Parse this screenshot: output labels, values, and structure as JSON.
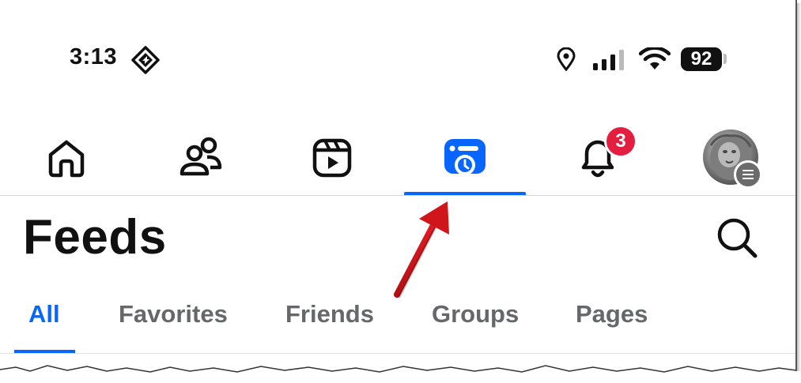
{
  "status_bar": {
    "time": "3:13",
    "battery": "92",
    "icons": [
      "location-icon",
      "signal-icon",
      "wifi-icon",
      "battery-icon"
    ]
  },
  "nav": {
    "items": [
      {
        "name": "home",
        "icon": "home-icon"
      },
      {
        "name": "friends",
        "icon": "friends-icon"
      },
      {
        "name": "video",
        "icon": "video-icon"
      },
      {
        "name": "feeds",
        "icon": "feeds-icon",
        "active": true
      },
      {
        "name": "notifications",
        "icon": "bell-icon",
        "badge": "3"
      },
      {
        "name": "menu",
        "icon": "avatar"
      }
    ]
  },
  "header": {
    "title": "Feeds"
  },
  "tabs": [
    {
      "label": "All",
      "active": true
    },
    {
      "label": "Favorites"
    },
    {
      "label": "Friends"
    },
    {
      "label": "Groups"
    },
    {
      "label": "Pages"
    }
  ],
  "colors": {
    "accent": "#0866ff",
    "badge": "#e41e3f",
    "arrow": "#d0151b",
    "inactive_text": "#65676b"
  }
}
